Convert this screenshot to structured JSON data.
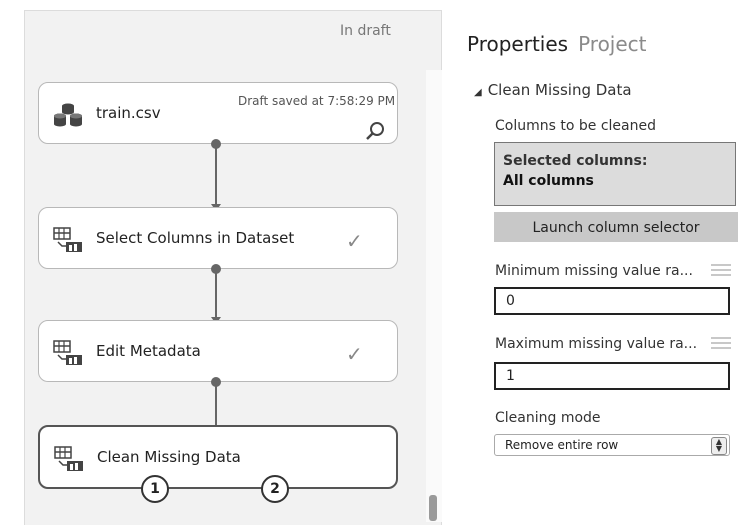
{
  "canvas": {
    "status": "In draft",
    "draft_saved": "Draft saved at 7:58:29 PM",
    "modules": [
      {
        "label": "train.csv",
        "icon": "dataset-icon"
      },
      {
        "label": "Select Columns in Dataset",
        "icon": "module-icon",
        "status": "completed"
      },
      {
        "label": "Edit Metadata",
        "icon": "module-icon",
        "status": "completed"
      },
      {
        "label": "Clean Missing Data",
        "icon": "module-icon",
        "selected": true
      }
    ],
    "output_ports": [
      "1",
      "2"
    ]
  },
  "properties": {
    "tabs": {
      "active": "Properties",
      "inactive": "Project"
    },
    "section_title": "Clean Missing Data",
    "columns_label": "Columns to be cleaned",
    "selected_columns_title": "Selected columns:",
    "selected_columns_value": "All columns",
    "launch_button": "Launch column selector",
    "min_label": "Minimum missing value ra...",
    "min_value": "0",
    "max_label": "Maximum missing value ra...",
    "max_value": "1",
    "cleaning_mode_label": "Cleaning mode",
    "cleaning_mode_value": "Remove entire row"
  }
}
